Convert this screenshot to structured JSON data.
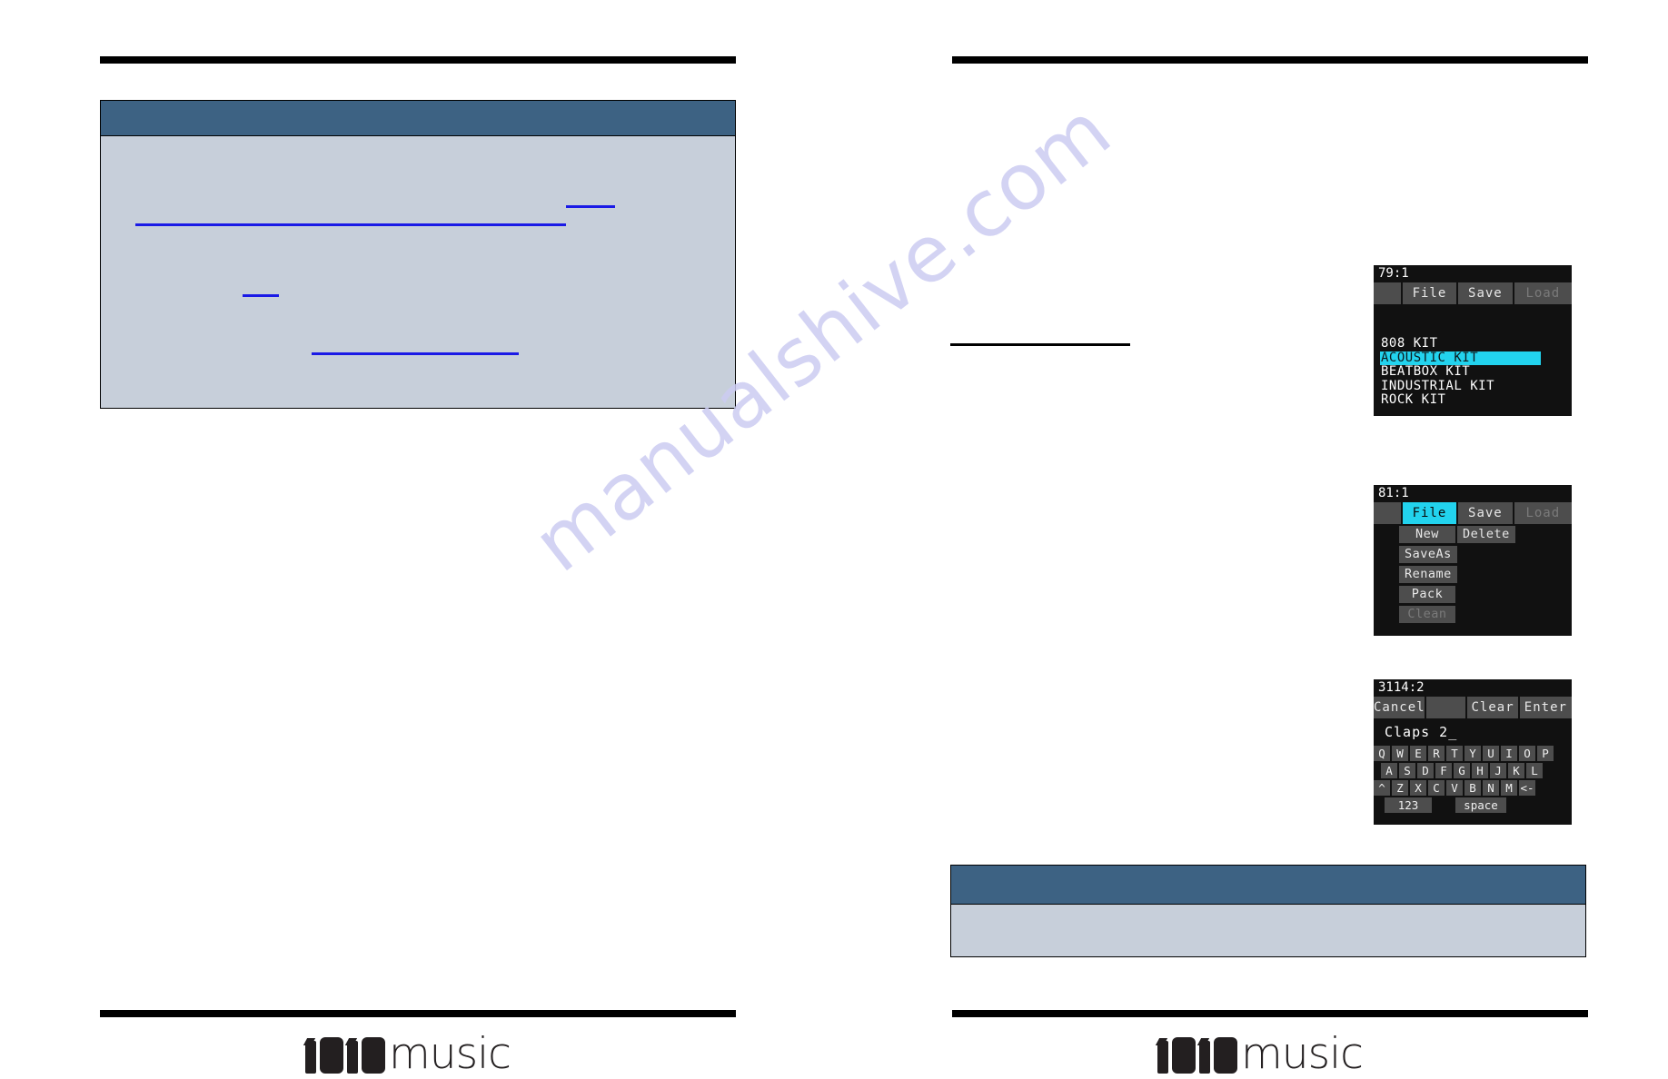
{
  "watermark": {
    "text": "manualshive.com"
  },
  "brand": {
    "logo_text": "music",
    "logo_digits": "1010"
  },
  "left_page": {
    "callout": {
      "header_text": "",
      "body_text": ""
    }
  },
  "right_page": {
    "callout": {
      "header_text": "",
      "body_text": ""
    }
  },
  "screens": [
    {
      "id": "kit-list-screen",
      "title": "79:1",
      "tabs": [
        {
          "label": "",
          "state": "blank"
        },
        {
          "label": "File",
          "state": "normal"
        },
        {
          "label": "Save",
          "state": "normal"
        },
        {
          "label": "Load",
          "state": "disabled"
        }
      ],
      "list": [
        {
          "label": "808 KIT",
          "selected": false
        },
        {
          "label": "ACOUSTIC KIT",
          "selected": true
        },
        {
          "label": "BEATBOX KIT",
          "selected": false
        },
        {
          "label": "INDUSTRIAL KIT",
          "selected": false
        },
        {
          "label": "ROCK KIT",
          "selected": false
        }
      ]
    },
    {
      "id": "file-menu-screen",
      "title": "81:1",
      "tabs": [
        {
          "label": "",
          "state": "blank"
        },
        {
          "label": "File",
          "state": "active"
        },
        {
          "label": "Save",
          "state": "normal"
        },
        {
          "label": "Load",
          "state": "disabled"
        }
      ],
      "menu_rows": [
        [
          {
            "label": "New",
            "state": "normal"
          },
          {
            "label": "Delete",
            "state": "normal"
          }
        ],
        [
          {
            "label": "SaveAs",
            "state": "normal"
          }
        ],
        [
          {
            "label": "Rename",
            "state": "normal"
          }
        ],
        [
          {
            "label": "Pack",
            "state": "normal"
          }
        ],
        [
          {
            "label": "Clean",
            "state": "disabled"
          }
        ]
      ]
    },
    {
      "id": "keyboard-screen",
      "title": "3114:2",
      "tabs": [
        {
          "label": "Cancel",
          "state": "normal"
        },
        {
          "label": "",
          "state": "blank"
        },
        {
          "label": "Clear",
          "state": "normal"
        },
        {
          "label": "Enter",
          "state": "normal"
        }
      ],
      "text_value": "Claps 2_",
      "keyboard": {
        "row1": [
          "Q",
          "W",
          "E",
          "R",
          "T",
          "Y",
          "U",
          "I",
          "O",
          "P"
        ],
        "row2": [
          "A",
          "S",
          "D",
          "F",
          "G",
          "H",
          "J",
          "K",
          "L"
        ],
        "row3": [
          "^",
          "Z",
          "X",
          "C",
          "V",
          "B",
          "N",
          "M",
          "<-"
        ],
        "row4": [
          "123",
          "space"
        ]
      }
    }
  ]
}
